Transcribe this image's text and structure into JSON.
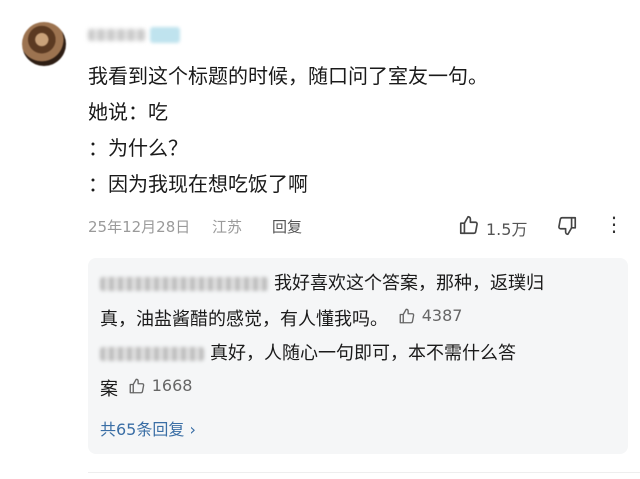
{
  "comment": {
    "user": {
      "name": "",
      "badge": ""
    },
    "lines": [
      "我看到这个标题的时候，随口问了室友一句。",
      "她说：吃",
      "：为什么？",
      "：因为我现在想吃饭了啊"
    ],
    "date": "25年12月28日",
    "location": "江苏",
    "reply_label": "回复",
    "like_count": "1.5万"
  },
  "replies": [
    {
      "text_line1": "我好喜欢这个答案，那种，返璞归",
      "text_line2": "真，油盐酱醋的感觉，有人懂我吗。",
      "likes": "4387"
    },
    {
      "text_line1": "真好，人随心一句即可，本不需什么答",
      "text_line2": "案",
      "likes": "1668"
    }
  ],
  "more_replies_label": "共65条回复 ›",
  "icons": {
    "like": "thumbs-up-icon",
    "dislike": "thumbs-down-icon",
    "more": "more-vertical-icon"
  }
}
